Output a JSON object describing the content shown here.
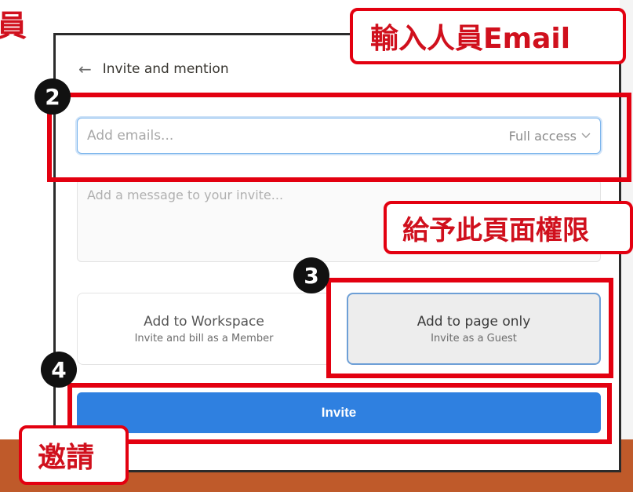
{
  "fragment_text": "員",
  "dialog": {
    "back_icon": "left-arrow-icon",
    "title": "Invite and mention",
    "email_placeholder": "Add emails...",
    "access_label": "Full access",
    "access_icon": "chevron-down-icon",
    "message_placeholder": "Add a message to your invite...",
    "option_workspace": {
      "title": "Add to Workspace",
      "subtitle": "Invite and bill as a Member"
    },
    "option_page": {
      "title": "Add to page only",
      "subtitle": "Invite as a Guest"
    },
    "invite_label": "Invite"
  },
  "annotations": {
    "step2": "2",
    "step3": "3",
    "step4": "4",
    "callout_email": "輸入人員Email",
    "callout_permission": "給予此頁面權限",
    "callout_invite": "邀請"
  },
  "colors": {
    "annotation_red": "#e30010",
    "invite_blue": "#2f80e0",
    "bottom_bar": "#bf5a2a"
  }
}
